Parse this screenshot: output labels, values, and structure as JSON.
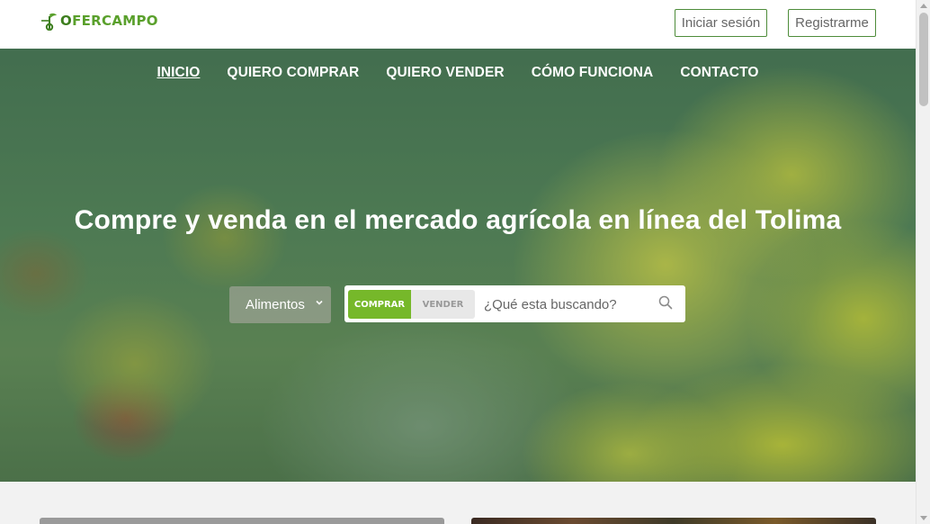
{
  "brand": {
    "name_prefix": "O",
    "name_rest": "FERCAMPO"
  },
  "header": {
    "login_label": "Iniciar sesión",
    "register_label": "Registrarme"
  },
  "nav": {
    "items": [
      {
        "label": "INICIO",
        "active": true
      },
      {
        "label": "QUIERO COMPRAR"
      },
      {
        "label": "QUIERO VENDER"
      },
      {
        "label": "CÓMO FUNCIONA"
      },
      {
        "label": "CONTACTO"
      }
    ]
  },
  "hero": {
    "headline": "Compre y venda en el mercado agrícola en línea del Tolima"
  },
  "search": {
    "category_selected": "Alimentos",
    "mode_buy_label": "COMPRAR",
    "mode_sell_label": "VENDER",
    "active_mode": "COMPRAR",
    "placeholder": "¿Qué esta buscando?"
  },
  "colors": {
    "brand_green": "#5aa02c",
    "buy_active": "#76b82a",
    "outline_green": "#4e8c3a"
  }
}
